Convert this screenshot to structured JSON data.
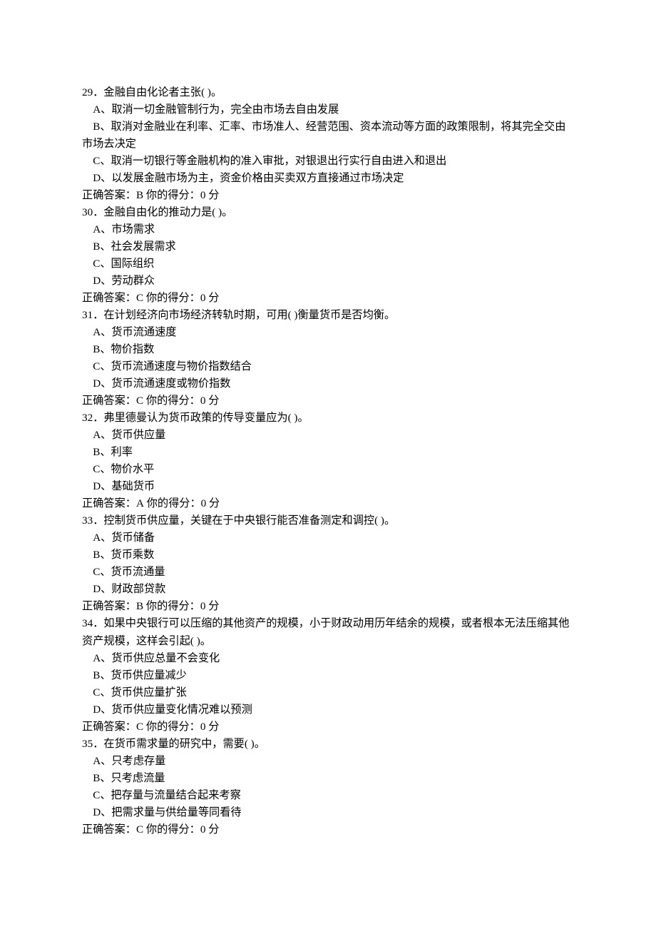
{
  "questions": [
    {
      "number": "29",
      "stem": "．金融自由化论者主张( )。",
      "options": [
        "A、取消一切金融管制行为，完全由市场去自由发展",
        "B、取消对金融业在利率、汇率、市场准人、经营范围、资本流动等方面的政策限制，将其完全交由市场去决定",
        "C、取消一切银行等金融机构的准入审批，对银退出行实行自由进入和退出",
        "D、以发展金融市场为主，资金价格由买卖双方直接通过市场决定"
      ],
      "answer_label": "正确答案：",
      "answer_value": "B",
      "score_label": " 你的得分：",
      "score_value": "0",
      "score_suffix": " 分"
    },
    {
      "number": "30",
      "stem": "．金融自由化的推动力是( )。",
      "options": [
        "A、市场需求",
        "B、社会发展需求",
        "C、国际组织",
        "D、劳动群众"
      ],
      "answer_label": "正确答案：",
      "answer_value": "C",
      "score_label": " 你的得分：",
      "score_value": "0",
      "score_suffix": " 分"
    },
    {
      "number": "31",
      "stem": "．在计划经济向市场经济转轨时期，可用( )衡量货币是否均衡。",
      "options": [
        "A、货币流通速度",
        "B、物价指数",
        "C、货币流通速度与物价指数结合",
        "D、货币流通速度或物价指数"
      ],
      "answer_label": "正确答案：",
      "answer_value": "C",
      "score_label": " 你的得分：",
      "score_value": "0",
      "score_suffix": " 分"
    },
    {
      "number": "32",
      "stem": "．弗里德曼认为货币政策的传导变量应为( )。",
      "options": [
        "A、货币供应量",
        "B、利率",
        "C、物价水平",
        "D、基础货币"
      ],
      "answer_label": "正确答案：",
      "answer_value": "A",
      "score_label": " 你的得分：",
      "score_value": "0",
      "score_suffix": " 分"
    },
    {
      "number": "33",
      "stem": "．控制货币供应量，关键在于中央银行能否准备测定和调控( )。",
      "options": [
        "A、货币储备",
        "B、货币乘数",
        "C、货币流通量",
        "D、财政部贷款"
      ],
      "answer_label": "正确答案：",
      "answer_value": "B",
      "score_label": " 你的得分：",
      "score_value": "0",
      "score_suffix": " 分"
    },
    {
      "number": "34",
      "stem": "．如果中央银行可以压缩的其他资产的规模，小于财政动用历年结余的规模，或者根本无法压缩其他资产规模，这样会引起( )。",
      "options": [
        "A、货币供应总量不会变化",
        "B、货币供应量减少",
        "C、货币供应量扩张",
        "D、货币供应量变化情况难以预测"
      ],
      "answer_label": "正确答案：",
      "answer_value": "C",
      "score_label": " 你的得分：",
      "score_value": "0",
      "score_suffix": " 分"
    },
    {
      "number": "35",
      "stem": "．在货币需求量的研究中，需要( )。",
      "options": [
        "A、只考虑存量",
        "B、只考虑流量",
        "C、把存量与流量结合起来考察",
        "D、把需求量与供给量等同看待"
      ],
      "answer_label": "正确答案：",
      "answer_value": "C",
      "score_label": " 你的得分：",
      "score_value": "0",
      "score_suffix": " 分"
    }
  ]
}
